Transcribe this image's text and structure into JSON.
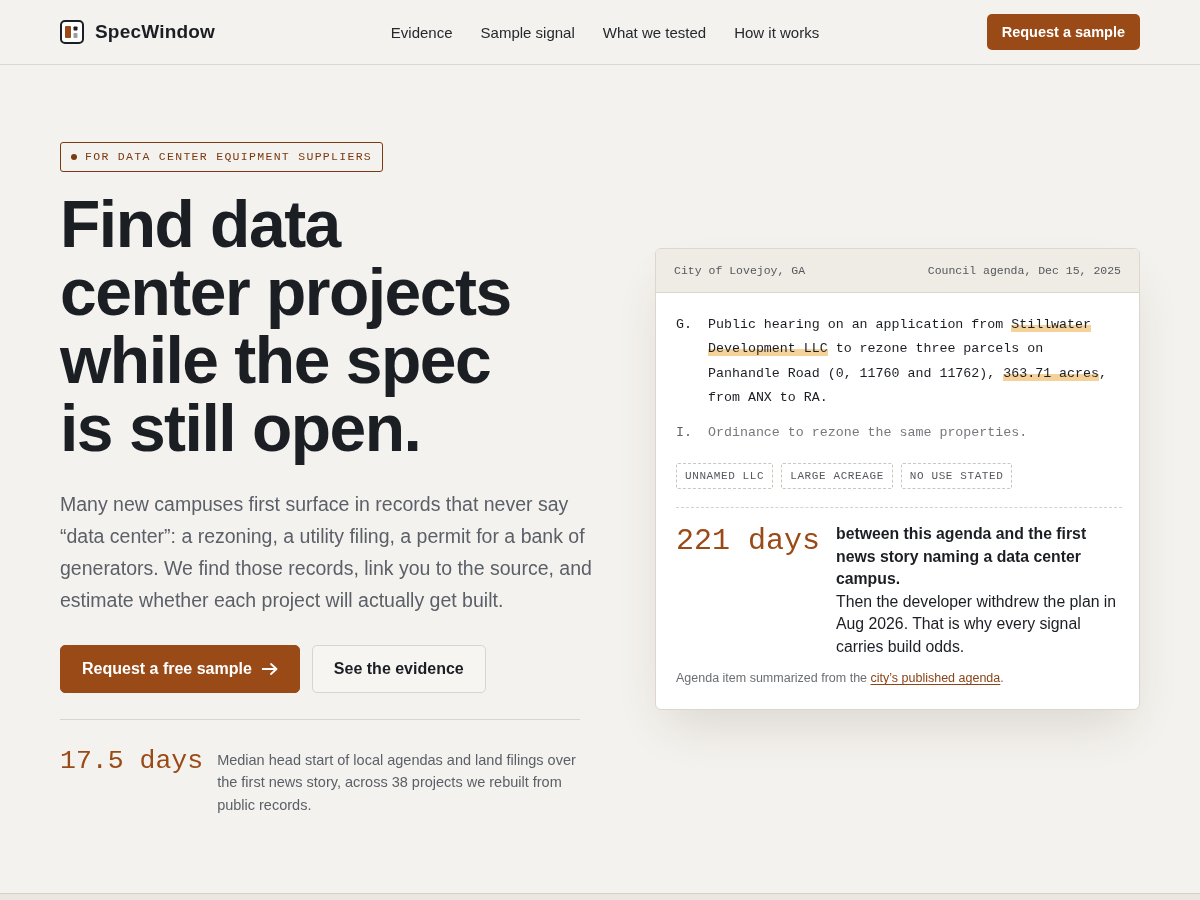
{
  "header": {
    "brand": "SpecWindow",
    "nav": [
      "Evidence",
      "Sample signal",
      "What we tested",
      "How it works"
    ],
    "cta": "Request a sample"
  },
  "hero": {
    "badge": "FOR DATA CENTER EQUIPMENT SUPPLIERS",
    "heading": "Find data center projects while the spec is still open.",
    "lede": "Many new campuses first surface in records that never say “data center”: a rezoning, a utility filing, a permit for a bank of generators. We find those records, link you to the source, and estimate whether each project will actually get built.",
    "buttons": [
      {
        "label": "Request a free sample",
        "kind": "primary"
      },
      {
        "label": "See the evidence",
        "kind": "secondary"
      }
    ],
    "stat": {
      "value": "17.5 days",
      "description": "Median head start of local agendas and land filings over the first news story, across 38 projects we rebuilt from public records."
    }
  },
  "agenda_card": {
    "place": "City of Lovejoy, GA",
    "source": "Council agenda, Dec 15, 2025",
    "items": [
      {
        "letter": "G.",
        "dimmed": false,
        "segments": [
          {
            "text": "Public hearing on an application from ",
            "highlighted": false
          },
          {
            "text": "Stillwater Development LLC",
            "highlighted": true
          },
          {
            "text": " to rezone three parcels on Panhandle Road (0, 11760 and 11762), ",
            "highlighted": false
          },
          {
            "text": "363.71 acres",
            "highlighted": true
          },
          {
            "text": ", from ANX to RA.",
            "highlighted": false
          }
        ]
      },
      {
        "letter": "I.",
        "dimmed": true,
        "segments": [
          {
            "text": "Ordinance to rezone the same properties.",
            "highlighted": false
          }
        ]
      }
    ],
    "tags": [
      "UNNAMED LLC",
      "LARGE ACREAGE",
      "NO USE STATED"
    ],
    "stat": {
      "value": "221 days",
      "headline": "between this agenda and the first news story naming a data center campus.",
      "detail": "Then the developer withdrew the plan in Aug 2026. That is why every signal carries build odds."
    },
    "note": {
      "text": "Agenda item summarized from the ",
      "link": "city’s published agenda",
      "end": "."
    }
  }
}
